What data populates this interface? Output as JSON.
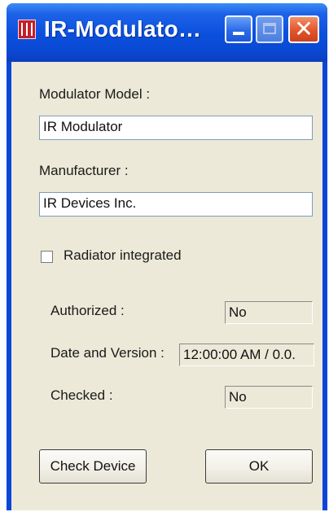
{
  "window": {
    "title": "IR-Modulato…"
  },
  "form": {
    "model_label": "Modulator Model :",
    "model_value": "IR Modulator",
    "manufacturer_label": "Manufacturer :",
    "manufacturer_value": "IR Devices Inc.",
    "radiator_label": "Radiator integrated",
    "radiator_checked": false,
    "authorized_label": "Authorized :",
    "authorized_value": "No",
    "date_version_label": "Date and Version :",
    "date_version_value": "12:00:00 AM / 0.0.",
    "checked_label": "Checked :",
    "checked_value": "No"
  },
  "buttons": {
    "check_device": "Check Device",
    "ok": "OK"
  },
  "colors": {
    "titlebar": "#0a4fdc",
    "client_bg": "#ece9d8",
    "close_button": "#e2552b"
  }
}
